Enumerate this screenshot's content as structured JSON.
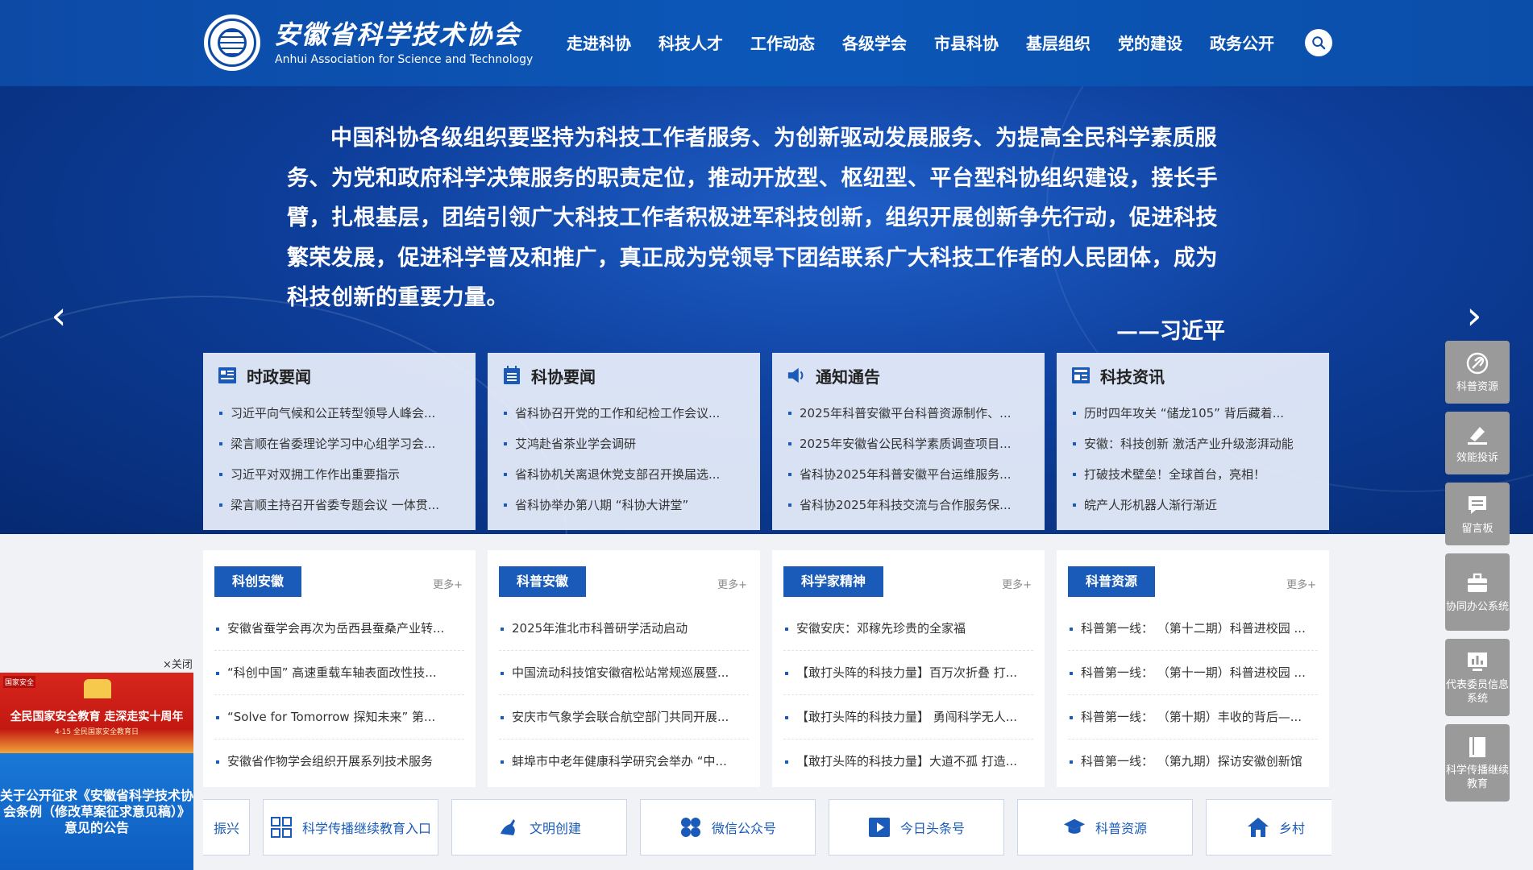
{
  "header": {
    "brand_cn": "安徽省科学技术协会",
    "brand_en": "Anhui Association for Science and Technology",
    "nav": [
      "走进科协",
      "科技人才",
      "工作动态",
      "各级学会",
      "市县科协",
      "基层组织",
      "党的建设",
      "政务公开"
    ]
  },
  "banner": {
    "quote": "中国科协各级组织要坚持为科技工作者服务、为创新驱动发展服务、为提高全民科学素质服务、为党和政府科学决策服务的职责定位，推动开放型、枢纽型、平台型科协组织建设，接长手臂，扎根基层，团结引领广大科技工作者积极进军科技创新，组织开展创新争先行动，促进科技繁荣发展，促进科学普及和推广，真正成为党领导下团结联系广大科技工作者的人民团体，成为科技创新的重要力量。",
    "author": "——习近平",
    "prev_arrow": "‹",
    "next_arrow": "›"
  },
  "panels": [
    {
      "title": "时政要闻",
      "icon": "news-icon",
      "items": [
        "习近平向气候和公正转型领导人峰会...",
        "梁言顺在省委理论学习中心组学习会...",
        "习近平对双拥工作作出重要指示",
        "梁言顺主持召开省委专题会议 一体贯..."
      ]
    },
    {
      "title": "科协要闻",
      "icon": "list-icon",
      "items": [
        "省科协召开党的工作和纪检工作会议...",
        "艾鸿赴省茶业学会调研",
        "省科协机关离退休党支部召开换届选...",
        "省科协举办第八期 “科协大讲堂”"
      ]
    },
    {
      "title": "通知通告",
      "icon": "speaker-icon",
      "items": [
        "2025年科普安徽平台科普资源制作、...",
        "2025年安徽省公民科学素质调查项目...",
        "省科协2025年科普安徽平台运维服务...",
        "省科协2025年科技交流与合作服务保..."
      ]
    },
    {
      "title": "科技资讯",
      "icon": "newspaper-icon",
      "items": [
        "历时四年攻关 “储龙105” 背后藏着...",
        "安徽：科技创新 激活产业升级澎湃动能",
        "打破技术壁垒！全球首台，亮相！",
        "皖产人形机器人渐行渐近"
      ]
    }
  ],
  "cards": [
    {
      "tag": "科创安徽",
      "more": "更多+",
      "items": [
        "安徽省蚕学会再次为岳西县蚕桑产业转...",
        "“科创中国” 高速重载车轴表面改性技...",
        "“Solve for Tomorrow 探知未来” 第...",
        "安徽省作物学会组织开展系列技术服务"
      ]
    },
    {
      "tag": "科普安徽",
      "more": "更多+",
      "items": [
        "2025年淮北市科普研学活动启动",
        "中国流动科技馆安徽宿松站常规巡展暨...",
        "安庆市气象学会联合航空部门共同开展...",
        "蚌埠市中老年健康科学研究会举办 “中..."
      ]
    },
    {
      "tag": "科学家精神",
      "more": "更多+",
      "items": [
        "安徽安庆：邓稼先珍贵的全家福",
        "【敢打头阵的科技力量】百万次折叠 打...",
        "【敢打头阵的科技力量】 勇闯科学无人...",
        "【敢打头阵的科技力量】大道不孤 打造..."
      ]
    },
    {
      "tag": "科普资源",
      "more": "更多+",
      "items": [
        "科普第一线： （第十二期）科普进校园 ...",
        "科普第一线： （第十一期）科普进校园 ...",
        "科普第一线： （第十期）丰收的背后—...",
        "科普第一线： （第九期）探访安徽创新馆"
      ]
    }
  ],
  "links": [
    {
      "label": "振兴",
      "icon": "partial-icon"
    },
    {
      "label": "科学传播继续教育入口",
      "icon": "grid-icon"
    },
    {
      "label": "文明创建",
      "icon": "hand-icon"
    },
    {
      "label": "微信公众号",
      "icon": "wechat-icon"
    },
    {
      "label": "今日头条号",
      "icon": "video-icon"
    },
    {
      "label": "科普资源",
      "icon": "graduation-cap-icon"
    },
    {
      "label": "乡村",
      "icon": "house-icon"
    }
  ],
  "ad": {
    "close": "×关闭",
    "badge": "国家安全",
    "top_line1": "全民国家安全教育 走深走实十周年",
    "top_line2": "4·15 全民国家安全教育日",
    "bottom_text": "关于公开征求《安徽省科学技术协会条例（修改草案征求意见稿）》意见的公告"
  },
  "side": [
    {
      "label": "科普资源",
      "icon": "leaf-icon"
    },
    {
      "label": "效能投诉",
      "icon": "pen-icon"
    },
    {
      "label": "留言板",
      "icon": "message-icon"
    },
    {
      "label": "协同办公系统",
      "icon": "briefcase-icon"
    },
    {
      "label": "代表委员信息系统",
      "icon": "chart-icon"
    },
    {
      "label": "科学传播继续教育",
      "icon": "book-icon"
    }
  ],
  "colors": {
    "primary": "#0d4aa6",
    "accent": "#1a5bb9",
    "side": "#9a9a9a"
  }
}
